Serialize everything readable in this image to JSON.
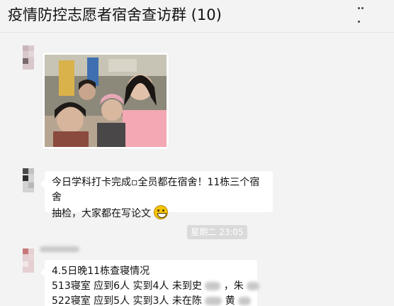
{
  "header": {
    "title": "疫情防控志愿者宿舍查访群 (10)",
    "more_icon": "more-icon"
  },
  "messages": [
    {
      "type": "image",
      "description_icon": "photo-image"
    },
    {
      "type": "text",
      "lines": [
        "今日学科打卡完成▫全员都在宿舍！11栋三个宿舍",
        "抽检，大家都在写论文"
      ],
      "emoji": "grin-emoji"
    },
    {
      "type": "time",
      "text": "星期二 23:05"
    },
    {
      "type": "text",
      "lines": [
        "4.5日晚11栋查寝情况",
        "513寝室 应到6人 实到4人 未到史",
        "522寝室 应到5人 实到3人 未在陈"
      ],
      "line1_tail": "，朱",
      "line2_tail": "黄"
    }
  ],
  "colors": {
    "background": "#f3f3f3",
    "bubble": "#ffffff",
    "time_chip": "#dadada"
  }
}
